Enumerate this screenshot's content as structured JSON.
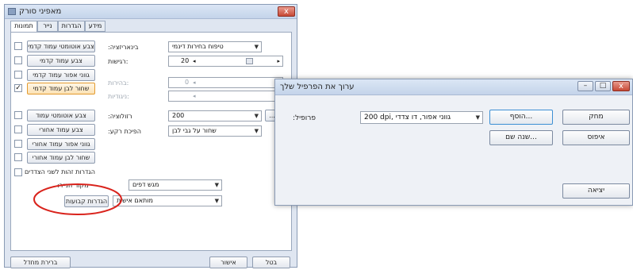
{
  "main_window": {
    "title": "מאפיני סורק",
    "close": "x",
    "tabs": [
      "תמונות",
      "נייר",
      "הגדרות",
      "מידע"
    ],
    "profiles_left": [
      {
        "label": "צבע אוטומטי עמוד קדמי",
        "checked": false
      },
      {
        "label": "צבע עמוד קדמי",
        "checked": false
      },
      {
        "label": "גווני אפור עמוד קדמי",
        "checked": false
      },
      {
        "label": "שחור לבן עמוד קדמי",
        "checked": true
      },
      {
        "label": "צבע אוטומטי עמוד אחורי",
        "checked": false
      },
      {
        "label": "צבע עמוד אחורי",
        "checked": false
      },
      {
        "label": "גווני אפור עמוד אחורי",
        "checked": false
      },
      {
        "label": "שחור לבן עמוד אחורי",
        "checked": false
      }
    ],
    "check_mark": "✓",
    "binarization_label": ":בינאריזציה",
    "binarization_value": "טיפוח בחירות דינמי",
    "sensitivity_label": "רגישות:",
    "sensitivity_value": "20",
    "brightness_label": "בהירות:",
    "brightness_value": "0",
    "contrast_label": "ניגודיות:",
    "resolution_label": ":רזולוציה",
    "resolution_value": "200",
    "invert_label": ":הפיכת רקע",
    "invert_value": "שחור על גבי לבן",
    "same_settings_label": "הגדרות זהות לשני הצדדים",
    "paper_source_label": ":מקור הנייר",
    "paper_source_value": "מגש דפים",
    "defaults_button": "הגדרות קבועות",
    "custom_value": "מותאם אישית",
    "default_button": "ברירת מחדל",
    "ok_button": "אישור",
    "cancel_button": "בטל",
    "small_button": "..."
  },
  "profile_dialog": {
    "title": "ערוך את הפרפיל שלך",
    "profile_label": ":פרופיל",
    "profile_value": "200 dpi, גווני אפור, דו צדדי",
    "add_button": "הוסף...",
    "delete_button": "מחק",
    "rename_button": "שנה שם...",
    "reset_button": "איפוס",
    "exit_button": "יציאה",
    "minimize": "–",
    "maximize": "□",
    "close": "x"
  },
  "annotation": {
    "color": "#d9231c"
  }
}
